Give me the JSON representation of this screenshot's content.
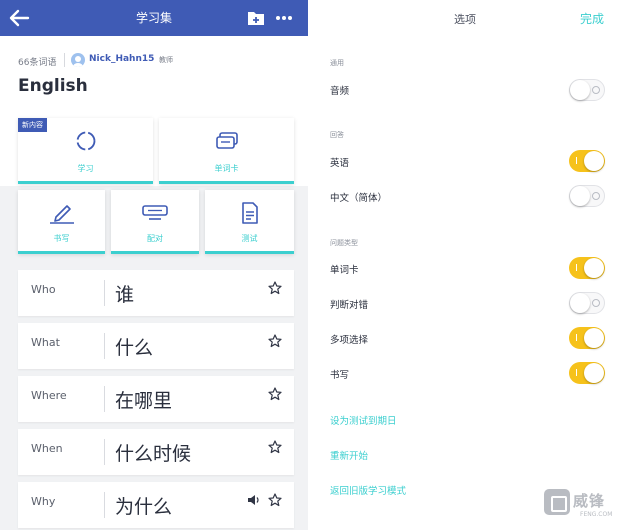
{
  "left": {
    "header": {
      "title": "学习集"
    },
    "meta": {
      "term_count": "66条词语",
      "username": "Nick_Hahn15",
      "role": "教师"
    },
    "set_title": "English",
    "badge": "新内容",
    "modes": [
      {
        "label": "学习",
        "icon": "learn-cycle-icon"
      },
      {
        "label": "单词卡",
        "icon": "flashcards-icon"
      },
      {
        "label": "书写",
        "icon": "write-pen-icon"
      },
      {
        "label": "配对",
        "icon": "match-icon"
      },
      {
        "label": "测试",
        "icon": "test-document-icon"
      }
    ],
    "words": [
      {
        "en": "Who",
        "zh": "谁"
      },
      {
        "en": "What",
        "zh": "什么"
      },
      {
        "en": "Where",
        "zh": "在哪里"
      },
      {
        "en": "When",
        "zh": "什么时候"
      },
      {
        "en": "Why",
        "zh": "为什么"
      }
    ]
  },
  "right": {
    "title": "选项",
    "done": "完成",
    "sections": {
      "general": "通用",
      "answer": "回答",
      "question_types": "问题类型"
    },
    "options": {
      "audio": {
        "label": "音频",
        "on": false
      },
      "english": {
        "label": "英语",
        "on": true
      },
      "chinese": {
        "label": "中文（简体）",
        "on": false
      },
      "flashcards": {
        "label": "单词卡",
        "on": true
      },
      "true_false": {
        "label": "判断对错",
        "on": false
      },
      "multiple_choice": {
        "label": "多项选择",
        "on": true
      },
      "written": {
        "label": "书写",
        "on": true
      }
    },
    "links": {
      "set_due_date": "设为测试到期日",
      "restart": "重新开始",
      "old_mode": "返回旧版学习模式"
    }
  },
  "watermark": {
    "cn": "威锋",
    "en": "FENG.COM"
  },
  "colors": {
    "header_blue": "#3f5bb5",
    "accent_teal": "#3ccfcf",
    "toggle_on": "#f6c21b"
  }
}
